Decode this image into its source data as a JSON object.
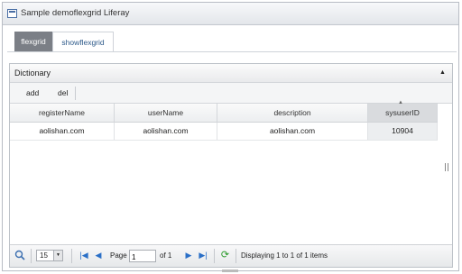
{
  "portlet": {
    "title": "Sample demoflexgrid Liferay"
  },
  "tabs": [
    {
      "label": "flexgrid",
      "active": false
    },
    {
      "label": "showflexgrid",
      "active": true
    }
  ],
  "grid": {
    "title": "Dictionary",
    "toolbar": {
      "add_label": "add",
      "del_label": "del"
    },
    "columns": [
      "registerName",
      "userName",
      "description",
      "sysuserID"
    ],
    "sorted_column": "sysuserID",
    "rows": [
      [
        "aolishan.com",
        "aolishan.com",
        "aolishan.com",
        "10904"
      ]
    ]
  },
  "pager": {
    "page_size": "15",
    "page_label": "Page",
    "page_value": "1",
    "of_label": "of 1",
    "display_text": "Displaying 1 to 1 of 1 items"
  },
  "colors": {
    "tab_inactive": "#7b7f86",
    "tab_active_text": "#2e5a8a",
    "nav_icon": "#2a6fc7",
    "refresh_icon": "#2a9a2a"
  },
  "icons": [
    "portlet-icon",
    "collapse-icon",
    "search-icon",
    "first-page-icon",
    "prev-page-icon",
    "next-page-icon",
    "last-page-icon",
    "refresh-icon"
  ]
}
